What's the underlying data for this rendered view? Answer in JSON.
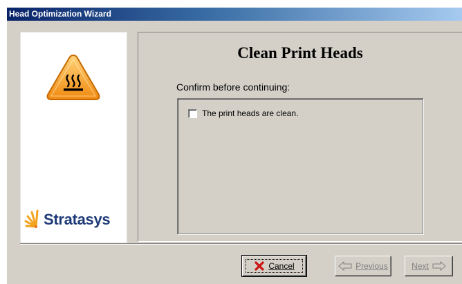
{
  "window": {
    "title": "Head Optimization Wizard"
  },
  "sidebar": {
    "warning_icon": "hot-surface-warning-icon",
    "logo_text": "Stratasys",
    "logo_mark": "stratasys-burst-icon"
  },
  "page": {
    "title": "Clean Print Heads",
    "confirm_label": "Confirm before continuing:",
    "checkbox": {
      "label": "The print heads are clean.",
      "checked": false
    }
  },
  "buttons": {
    "cancel_label": "Cancel",
    "cancel_icon": "red-x-icon",
    "previous_label": "Previous",
    "previous_icon": "left-arrow-icon",
    "next_label": "Next",
    "next_icon": "right-arrow-icon",
    "previous_enabled": false,
    "next_enabled": false
  },
  "colors": {
    "title_bar_start": "#0a246a",
    "title_bar_end": "#a6caf0",
    "dialog_bg": "#d4d0c8",
    "warning_fill": "#f5a623",
    "logo_text": "#1e3a78",
    "logo_mark": "#f2a21c",
    "cancel_x": "#cc1111"
  }
}
